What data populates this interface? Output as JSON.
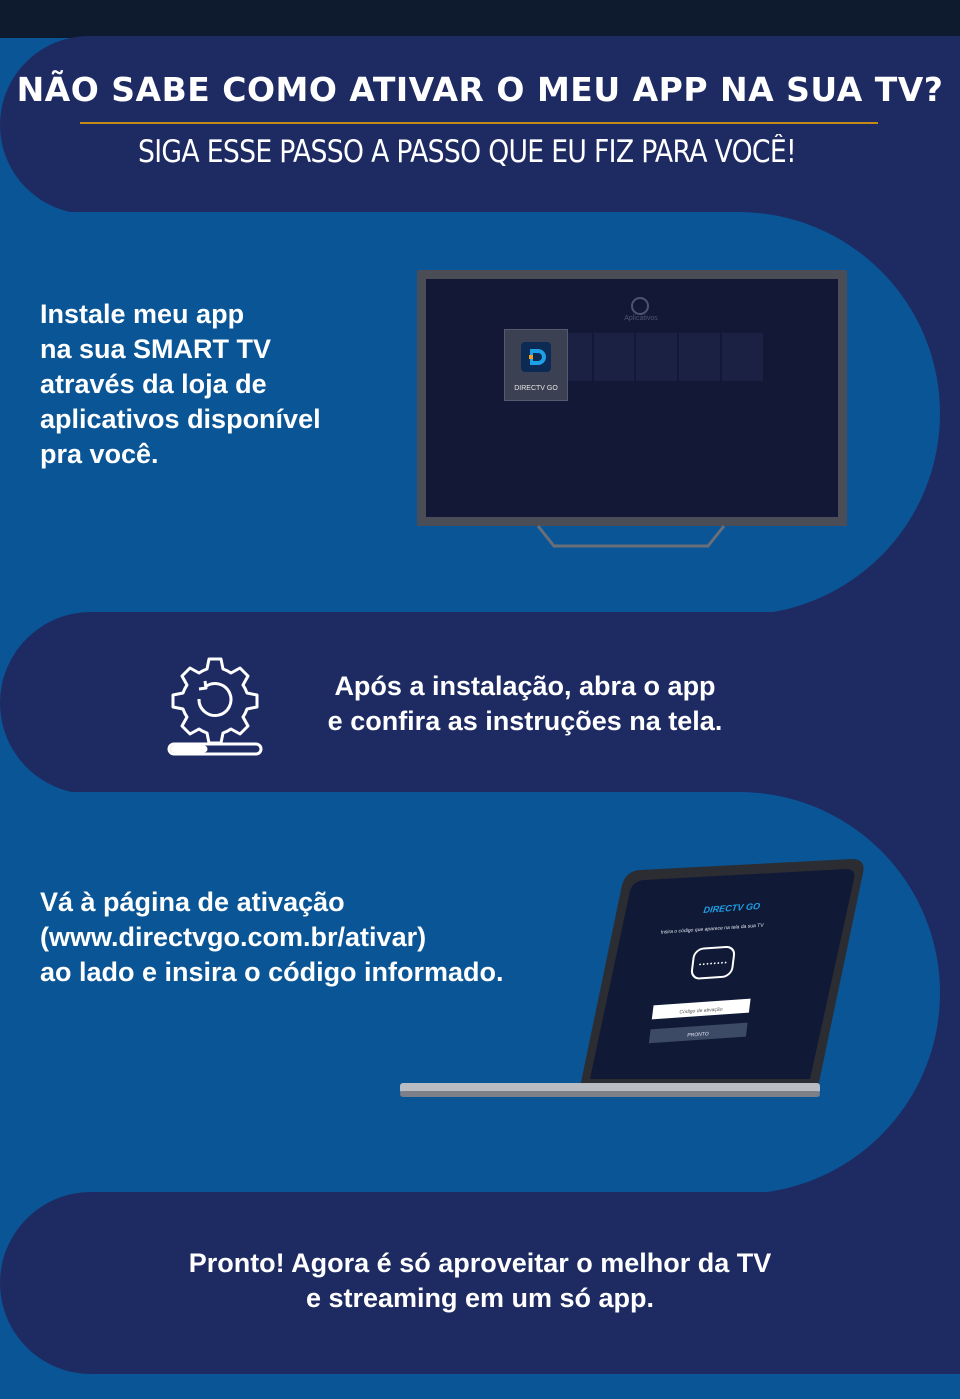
{
  "header": {
    "title": "NÃO SABE COMO ATIVAR O MEU APP NA SUA TV?",
    "subtitle": "SIGA ESSE PASSO A PASSO QUE EU FIZ PARA VOCÊ!"
  },
  "steps": [
    {
      "text": "Instale meu app\nna sua SMART TV\natravés da loja de\naplicativos disponível\npra você."
    },
    {
      "text": "Após a instalação, abra o app\ne confira as instruções na tela."
    },
    {
      "text": "Vá à página de ativação\n(www.directvgo.com.br/ativar)\nao lado e insira o código informado."
    },
    {
      "text": "Pronto! Agora é só aproveitar o melhor da TV\ne streaming em um só app."
    }
  ],
  "tv": {
    "app_label": "DIRECTV GO",
    "menu_label": "Aplicativos"
  },
  "laptop": {
    "brand": "DIRECTV GO",
    "instruction": "Insira o código que aparece na tela da sua TV",
    "input_placeholder": "Código de ativação",
    "button_label": "PRONTO"
  },
  "icons": [
    "gear-loading-icon",
    "tv-icon",
    "laptop-icon"
  ],
  "colors": {
    "navy": "#1e2b63",
    "blue": "#0a5596",
    "accent": "#c48a18",
    "top": "#0e1a2e"
  }
}
